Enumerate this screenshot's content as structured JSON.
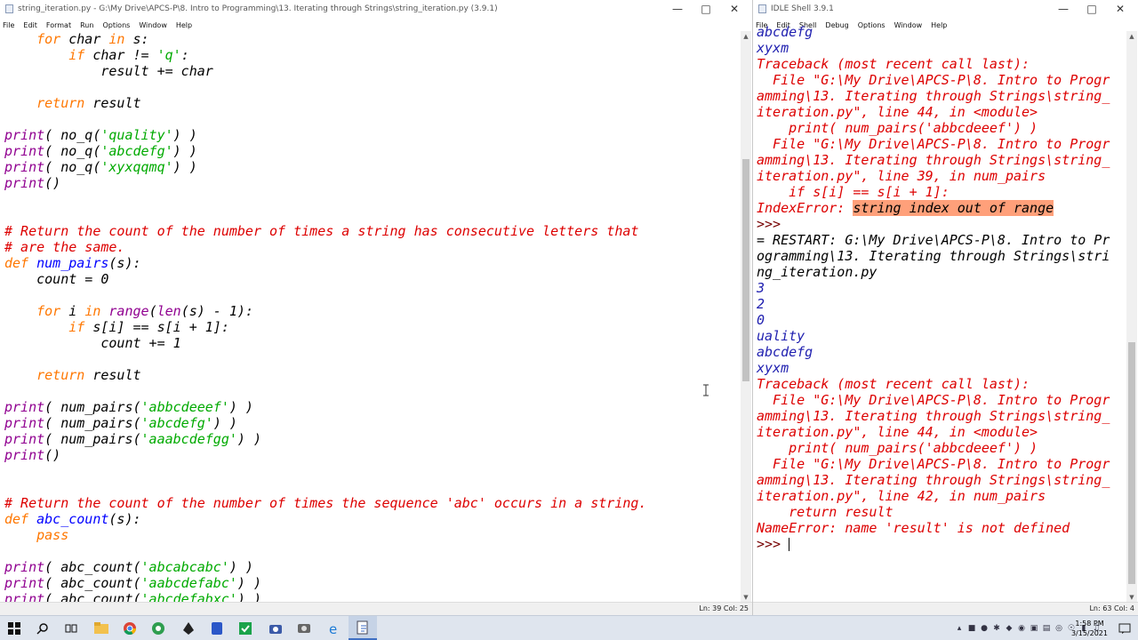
{
  "editor": {
    "title": "string_iteration.py - G:\\My Drive\\APCS-P\\8. Intro to Programming\\13. Iterating through Strings\\string_iteration.py (3.9.1)",
    "menu": [
      "File",
      "Edit",
      "Format",
      "Run",
      "Options",
      "Window",
      "Help"
    ],
    "status": "Ln: 39    Col: 25",
    "code_lines": [
      [
        [
          "kw",
          "    for"
        ],
        [
          "n",
          " char "
        ],
        [
          "kw",
          "in"
        ],
        [
          "n",
          " s:"
        ]
      ],
      [
        [
          "kw",
          "        if"
        ],
        [
          "n",
          " char != "
        ],
        [
          "st",
          "'q'"
        ],
        [
          "n",
          ":"
        ]
      ],
      [
        [
          "n",
          "            result += char"
        ]
      ],
      [
        [
          "n",
          ""
        ]
      ],
      [
        [
          "kw",
          "    return"
        ],
        [
          "n",
          " result"
        ]
      ],
      [
        [
          "n",
          ""
        ]
      ],
      [
        [
          "bi",
          "print"
        ],
        [
          "n",
          "( no_q("
        ],
        [
          "st",
          "'quality'"
        ],
        [
          "n",
          ") )"
        ]
      ],
      [
        [
          "bi",
          "print"
        ],
        [
          "n",
          "( no_q("
        ],
        [
          "st",
          "'abcdefg'"
        ],
        [
          "n",
          ") )"
        ]
      ],
      [
        [
          "bi",
          "print"
        ],
        [
          "n",
          "( no_q("
        ],
        [
          "st",
          "'xyxqqmq'"
        ],
        [
          "n",
          ") )"
        ]
      ],
      [
        [
          "bi",
          "print"
        ],
        [
          "n",
          "()"
        ]
      ],
      [
        [
          "n",
          ""
        ]
      ],
      [
        [
          "n",
          ""
        ]
      ],
      [
        [
          "cm",
          "# Return the count of the number of times a string has consecutive letters that"
        ]
      ],
      [
        [
          "cm",
          "# are the same."
        ]
      ],
      [
        [
          "kw",
          "def"
        ],
        [
          "n",
          " "
        ],
        [
          "df",
          "num_pairs"
        ],
        [
          "n",
          "(s):"
        ]
      ],
      [
        [
          "n",
          "    count = 0"
        ]
      ],
      [
        [
          "n",
          ""
        ]
      ],
      [
        [
          "kw",
          "    for"
        ],
        [
          "n",
          " i "
        ],
        [
          "kw",
          "in"
        ],
        [
          "n",
          " "
        ],
        [
          "bi",
          "range"
        ],
        [
          "n",
          "("
        ],
        [
          "bi",
          "len"
        ],
        [
          "n",
          "(s) - 1):"
        ]
      ],
      [
        [
          "kw",
          "        if"
        ],
        [
          "n",
          " s[i] == s[i + 1]:"
        ]
      ],
      [
        [
          "n",
          "            count += 1"
        ]
      ],
      [
        [
          "n",
          ""
        ]
      ],
      [
        [
          "kw",
          "    return"
        ],
        [
          "n",
          " result"
        ]
      ],
      [
        [
          "n",
          ""
        ]
      ],
      [
        [
          "bi",
          "print"
        ],
        [
          "n",
          "( num_pairs("
        ],
        [
          "st",
          "'abbcdeeef'"
        ],
        [
          "n",
          ") )"
        ]
      ],
      [
        [
          "bi",
          "print"
        ],
        [
          "n",
          "( num_pairs("
        ],
        [
          "st",
          "'abcdefg'"
        ],
        [
          "n",
          ") )"
        ]
      ],
      [
        [
          "bi",
          "print"
        ],
        [
          "n",
          "( num_pairs("
        ],
        [
          "st",
          "'aaabcdefgg'"
        ],
        [
          "n",
          ") )"
        ]
      ],
      [
        [
          "bi",
          "print"
        ],
        [
          "n",
          "()"
        ]
      ],
      [
        [
          "n",
          ""
        ]
      ],
      [
        [
          "n",
          ""
        ]
      ],
      [
        [
          "cm",
          "# Return the count of the number of times the sequence 'abc' occurs in a string."
        ]
      ],
      [
        [
          "kw",
          "def"
        ],
        [
          "n",
          " "
        ],
        [
          "df",
          "abc_count"
        ],
        [
          "n",
          "(s):"
        ]
      ],
      [
        [
          "kw",
          "    pass"
        ]
      ],
      [
        [
          "n",
          ""
        ]
      ],
      [
        [
          "bi",
          "print"
        ],
        [
          "n",
          "( abc_count("
        ],
        [
          "st",
          "'abcabcabc'"
        ],
        [
          "n",
          ") )"
        ]
      ],
      [
        [
          "bi",
          "print"
        ],
        [
          "n",
          "( abc_count("
        ],
        [
          "st",
          "'aabcdefabc'"
        ],
        [
          "n",
          ") )"
        ]
      ],
      [
        [
          "bi",
          "print"
        ],
        [
          "n",
          "( abc_count("
        ],
        [
          "st",
          "'abcdefabxc'"
        ],
        [
          "n",
          ") )"
        ]
      ]
    ]
  },
  "shell": {
    "title": "IDLE Shell 3.9.1",
    "menu": [
      "File",
      "Edit",
      "Shell",
      "Debug",
      "Options",
      "Window",
      "Help"
    ],
    "status": "Ln: 63    Col: 4",
    "output_lines": [
      [
        [
          "out",
          "abcdefg"
        ]
      ],
      [
        [
          "out",
          "xyxm"
        ]
      ],
      [
        [
          "n",
          ""
        ]
      ],
      [
        [
          "err",
          "Traceback (most recent call last):"
        ]
      ],
      [
        [
          "err",
          "  File \"G:\\My Drive\\APCS-P\\8. Intro to Progr"
        ]
      ],
      [
        [
          "err",
          "amming\\13. Iterating through Strings\\string_"
        ]
      ],
      [
        [
          "err",
          "iteration.py\", line 44, in <module>"
        ]
      ],
      [
        [
          "err",
          "    print( num_pairs('abbcdeeef') )"
        ]
      ],
      [
        [
          "err",
          "  File \"G:\\My Drive\\APCS-P\\8. Intro to Progr"
        ]
      ],
      [
        [
          "err",
          "amming\\13. Iterating through Strings\\string_"
        ]
      ],
      [
        [
          "err",
          "iteration.py\", line 39, in num_pairs"
        ]
      ],
      [
        [
          "err",
          "    if s[i] == s[i + 1]:"
        ]
      ],
      [
        [
          "err",
          "IndexError: "
        ],
        [
          "errhl",
          "string index out of range"
        ]
      ],
      [
        [
          "prompt",
          ">>>"
        ]
      ],
      [
        [
          "n",
          "= RESTART: G:\\My Drive\\APCS-P\\8. Intro to Pr"
        ]
      ],
      [
        [
          "n",
          "ogramming\\13. Iterating through Strings\\stri"
        ]
      ],
      [
        [
          "n",
          "ng_iteration.py"
        ]
      ],
      [
        [
          "out",
          "3"
        ]
      ],
      [
        [
          "out",
          "2"
        ]
      ],
      [
        [
          "out",
          "0"
        ]
      ],
      [
        [
          "n",
          ""
        ]
      ],
      [
        [
          "out",
          "uality"
        ]
      ],
      [
        [
          "out",
          "abcdefg"
        ]
      ],
      [
        [
          "out",
          "xyxm"
        ]
      ],
      [
        [
          "n",
          ""
        ]
      ],
      [
        [
          "err",
          "Traceback (most recent call last):"
        ]
      ],
      [
        [
          "err",
          "  File \"G:\\My Drive\\APCS-P\\8. Intro to Progr"
        ]
      ],
      [
        [
          "err",
          "amming\\13. Iterating through Strings\\string_"
        ]
      ],
      [
        [
          "err",
          "iteration.py\", line 44, in <module>"
        ]
      ],
      [
        [
          "err",
          "    print( num_pairs('abbcdeeef') )"
        ]
      ],
      [
        [
          "err",
          "  File \"G:\\My Drive\\APCS-P\\8. Intro to Progr"
        ]
      ],
      [
        [
          "err",
          "amming\\13. Iterating through Strings\\string_"
        ]
      ],
      [
        [
          "err",
          "iteration.py\", line 42, in num_pairs"
        ]
      ],
      [
        [
          "err",
          "    return result"
        ]
      ],
      [
        [
          "err",
          "NameError: name 'result' is not defined"
        ]
      ],
      [
        [
          "prompt",
          ">>> "
        ]
      ]
    ]
  },
  "taskbar": {
    "time": "1:58 PM",
    "date": "3/15/2021",
    "apps": [
      "start-icon",
      "search-icon",
      "task-view-icon",
      "file-explorer-icon",
      "chrome-icon",
      "green-app-icon",
      "inkscape-icon",
      "blue-app-icon",
      "checkmark-app-icon",
      "camera-icon",
      "screenshot-icon",
      "edge-icon",
      "idle-icon"
    ]
  }
}
